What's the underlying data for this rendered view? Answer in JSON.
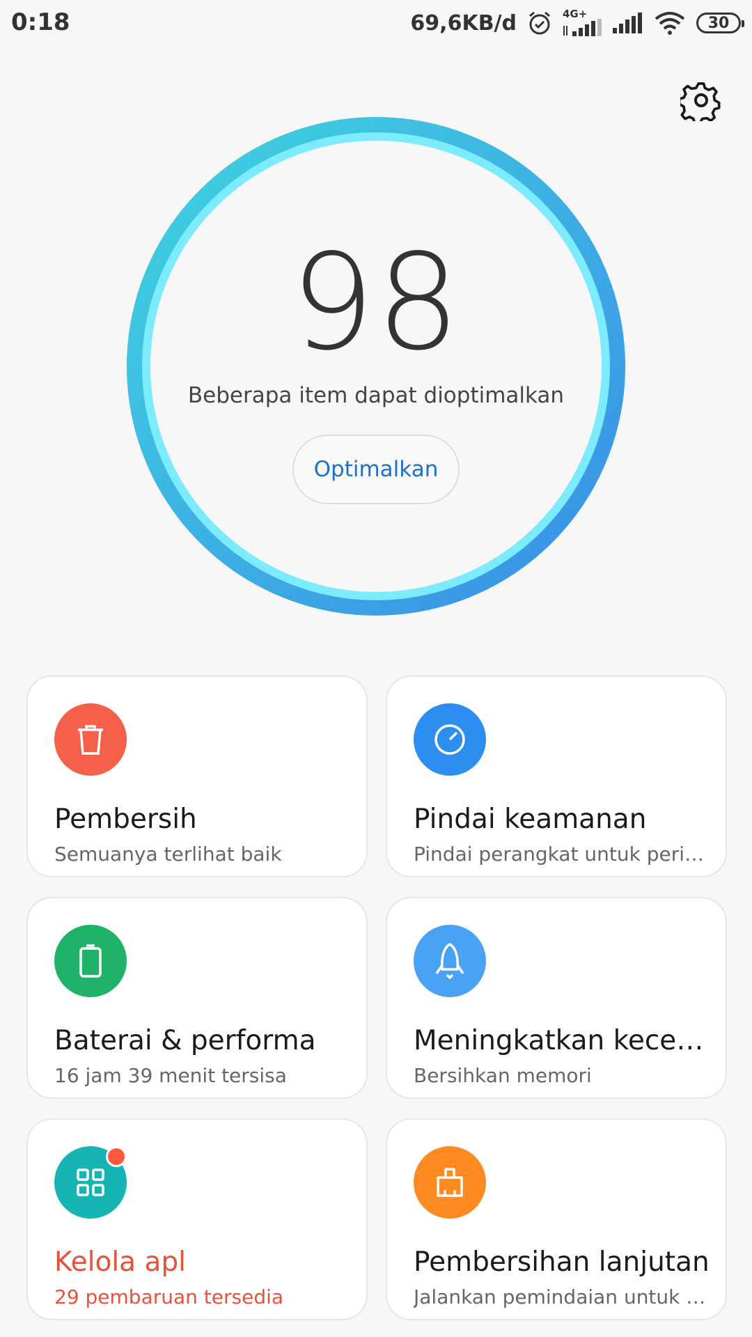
{
  "status_bar": {
    "time": "0:18",
    "net_speed": "69,6KB/d",
    "network_label": "4G+",
    "battery": "30"
  },
  "settings": {
    "icon": "gear-icon"
  },
  "score_panel": {
    "score": "98",
    "message": "Beberapa item dapat dioptimalkan",
    "button_label": "Optimalkan"
  },
  "cards": [
    {
      "title": "Pembersih",
      "subtitle": "Semuanya terlihat baik",
      "icon": "trash-icon",
      "color": "#f4604a"
    },
    {
      "title": "Pindai keamanan",
      "subtitle": "Pindai perangkat untuk periksa...",
      "icon": "gauge-icon",
      "color": "#2b8ef0"
    },
    {
      "title": "Baterai & performa",
      "subtitle": "16 jam 39 menit  tersisa",
      "icon": "battery-icon",
      "color": "#1fb36a"
    },
    {
      "title": "Meningkatkan kecepa...",
      "subtitle": "Bersihkan memori",
      "icon": "rocket-icon",
      "color": "#4aa2f5"
    },
    {
      "title": "Kelola apl",
      "subtitle": "29 pembaruan tersedia",
      "icon": "apps-grid-icon",
      "color": "#17b4b4"
    },
    {
      "title": "Pembersihan lanjutan",
      "subtitle": "Jalankan pemindaian untuk me...",
      "icon": "broom-icon",
      "color": "#ff8a22"
    }
  ],
  "colors": {
    "ring_outer_start": "#3ecfe0",
    "ring_outer_end": "#3a8fe6",
    "ring_inner": "#7eeaff",
    "accent_blue": "#1a73c9",
    "alert_red": "#e8513a"
  }
}
